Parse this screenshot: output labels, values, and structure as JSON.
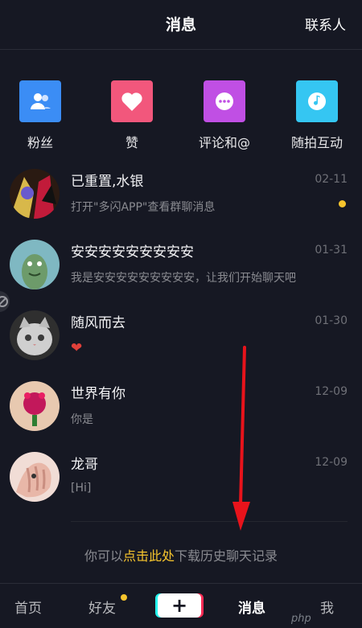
{
  "header": {
    "title": "消息",
    "contacts": "联系人"
  },
  "quick_actions": [
    {
      "label": "粉丝",
      "icon": "fans-icon",
      "color": "#3b8df5"
    },
    {
      "label": "赞",
      "icon": "heart-icon",
      "color": "#f2577c"
    },
    {
      "label": "评论和@",
      "icon": "comment-icon",
      "color": "#c04fe4"
    },
    {
      "label": "随拍互动",
      "icon": "music-icon",
      "color": "#35c6f2"
    }
  ],
  "conversations": [
    {
      "name": "已重置,水银",
      "preview": "打开\"多闪APP\"查看群聊消息",
      "time": "02-11",
      "unread": true
    },
    {
      "name": "安安安安安安安安安",
      "preview": "我是安安安安安安安安安，让我们开始聊天吧",
      "time": "01-31",
      "unread": false
    },
    {
      "name": "随风而去",
      "preview": "❤",
      "time": "01-30",
      "unread": false
    },
    {
      "name": "世界有你",
      "preview": "你是",
      "time": "12-09",
      "unread": false
    },
    {
      "name": "龙哥",
      "preview": "[Hi]",
      "time": "12-09",
      "unread": false
    }
  ],
  "history": {
    "prefix": "你可以",
    "link": "点击此处",
    "suffix": "下载历史聊天记录"
  },
  "tabbar": {
    "home": "首页",
    "friends": "好友",
    "create": "+",
    "messages": "消息",
    "me": "我"
  },
  "watermark": "php",
  "colors": {
    "background": "#161823",
    "accent": "#f6c42d",
    "arrow": "#e8131b"
  }
}
